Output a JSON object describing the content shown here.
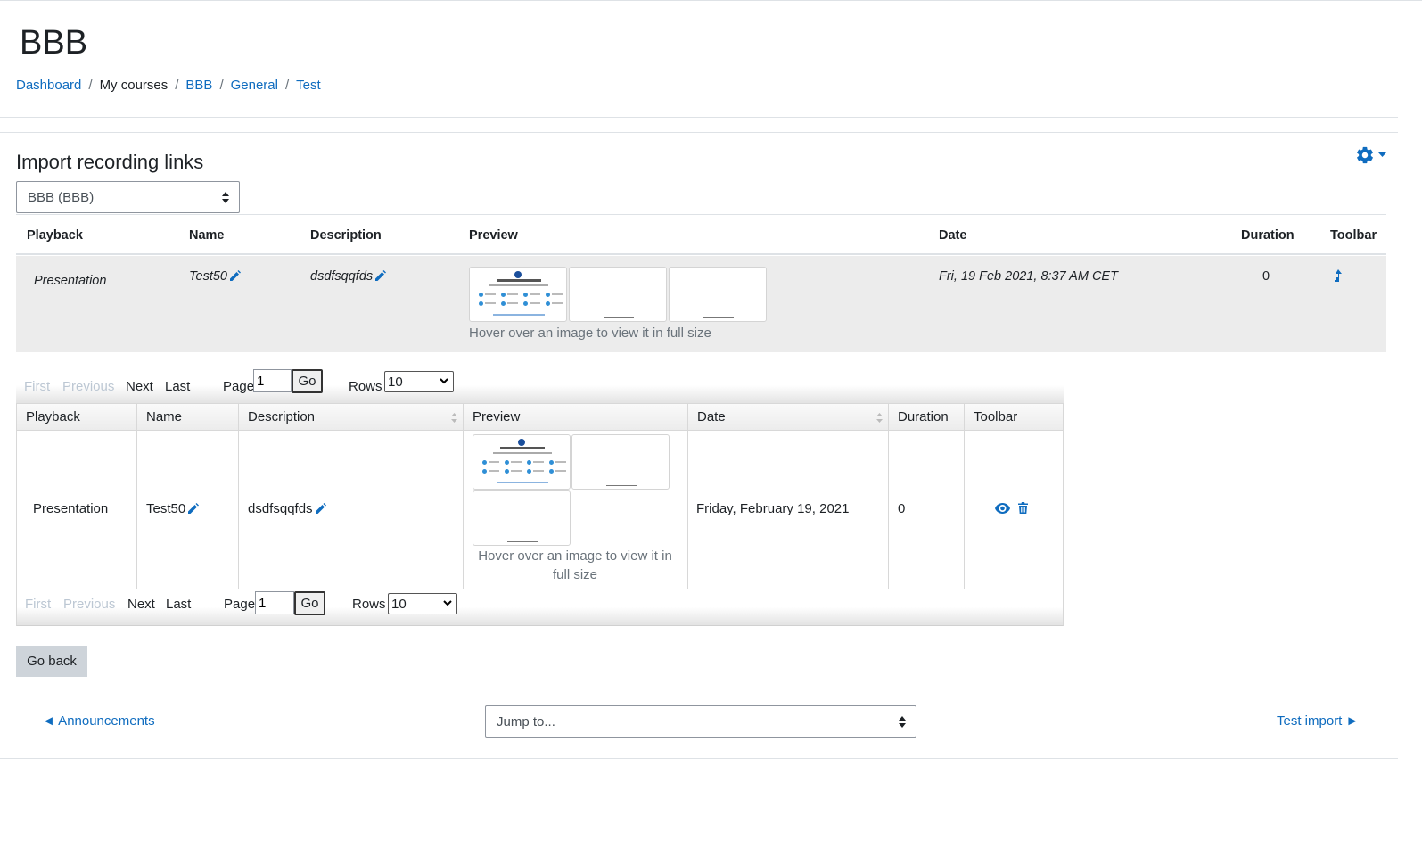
{
  "page": {
    "title": "BBB",
    "breadcrumb": [
      {
        "label": "Dashboard",
        "link": true
      },
      {
        "label": "My courses",
        "link": false
      },
      {
        "label": "BBB",
        "link": true
      },
      {
        "label": "General",
        "link": true
      },
      {
        "label": "Test",
        "link": true
      }
    ]
  },
  "section": {
    "title": "Import recording links",
    "gear_icon": "gear-icon",
    "course_select": {
      "value": "BBB (BBB)"
    }
  },
  "import_table": {
    "headers": [
      "Playback",
      "Name",
      "Description",
      "Preview",
      "Date",
      "Duration",
      "Toolbar"
    ],
    "row": {
      "playback": "Presentation",
      "name": "Test50",
      "description": "dsdfsqqfds",
      "preview_hint": "Hover over an image to view it in full size",
      "date": "Fri, 19 Feb 2021, 8:37 AM CET",
      "duration": "0",
      "toolbar_icon": "import-arrow-icon"
    }
  },
  "pager": {
    "first": "First",
    "previous": "Previous",
    "next": "Next",
    "last": "Last",
    "page_label": "Page",
    "page_value": "1",
    "go": "Go",
    "rows_label": "Rows",
    "rows_value": "10"
  },
  "recordings_table": {
    "headers": [
      "Playback",
      "Name",
      "Description",
      "Preview",
      "Date",
      "Duration",
      "Toolbar"
    ],
    "row": {
      "playback": "Presentation",
      "name": "Test50",
      "description": "dsdfsqqfds",
      "preview_hint_line1": "Hover over an image to view it in",
      "preview_hint_line2": "full size",
      "date": "Friday, February 19, 2021",
      "duration": "0",
      "toolbar_icons": [
        "eye-icon",
        "trash-icon"
      ]
    }
  },
  "actions": {
    "go_back": "Go back"
  },
  "activity_nav": {
    "prev": "◄ Announcements",
    "jump_placeholder": "Jump to...",
    "next": "Test import ►"
  },
  "colors": {
    "link": "#0f6cbf",
    "row_highlight": "#ececec",
    "button_secondary": "#ced4da"
  }
}
